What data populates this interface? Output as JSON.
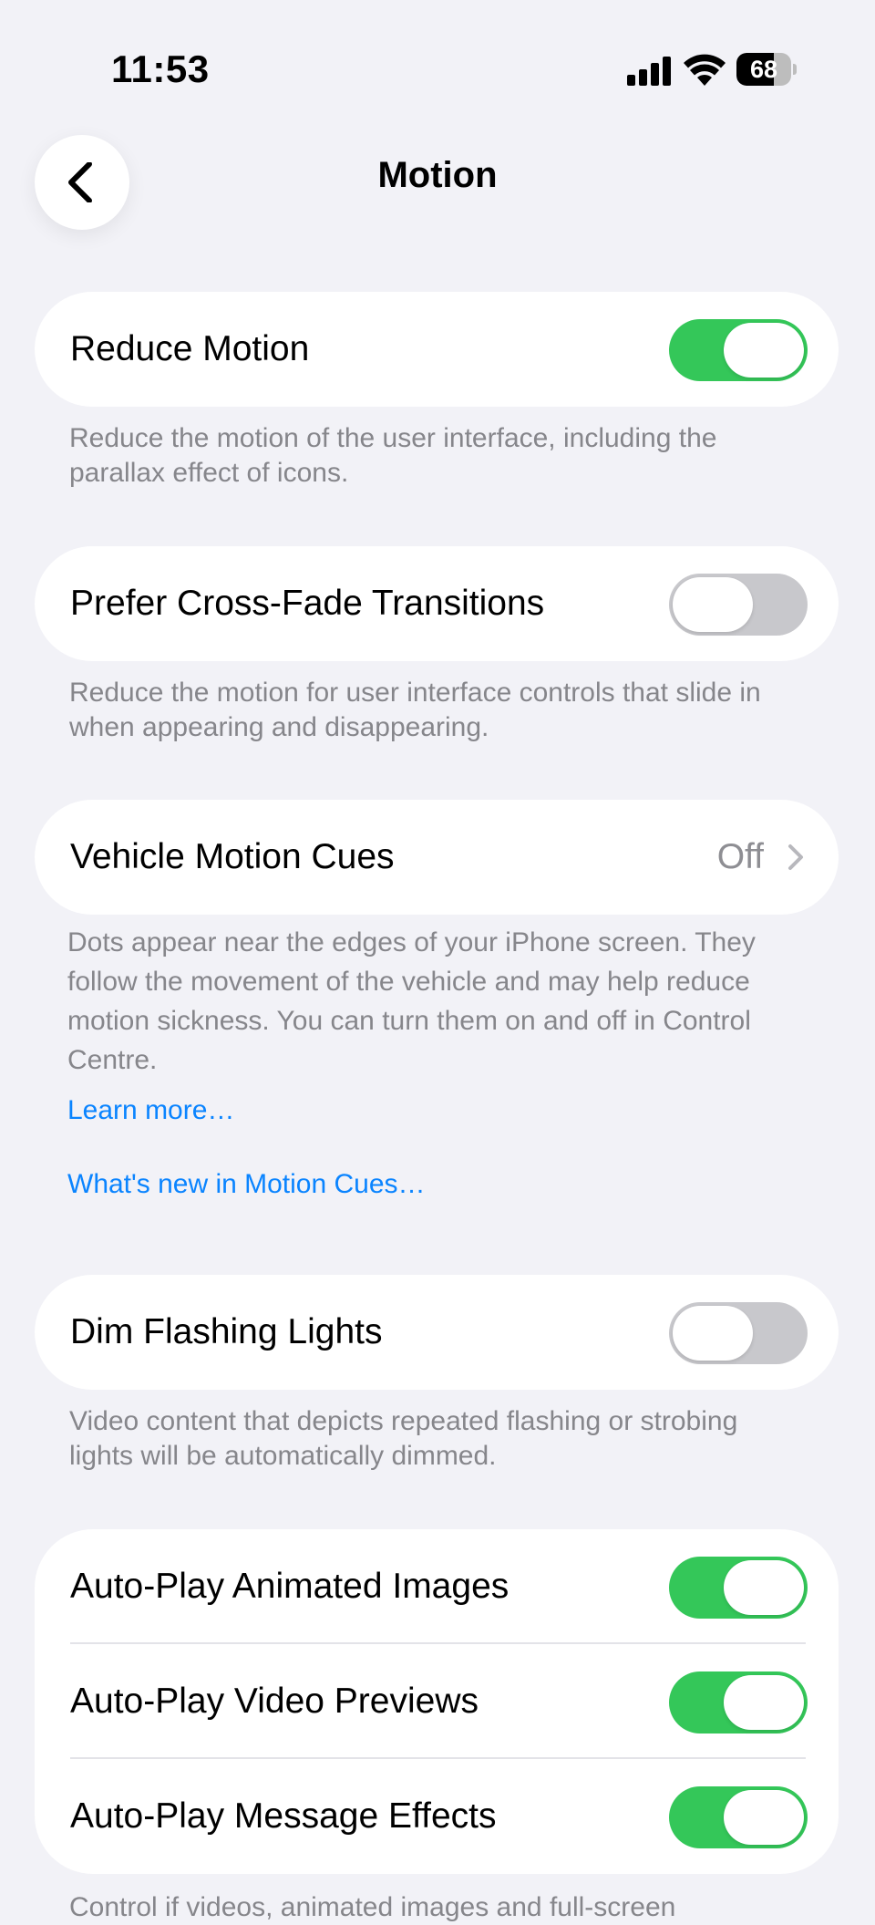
{
  "status_bar": {
    "time": "11:53",
    "battery": "68",
    "battery_level": 0.68
  },
  "nav": {
    "title": "Motion"
  },
  "settings": {
    "reduce_motion": {
      "label": "Reduce Motion",
      "on": true,
      "footer": "Reduce the motion of the user interface, including the parallax effect of icons."
    },
    "cross_fade": {
      "label": "Prefer Cross-Fade Transitions",
      "on": false,
      "footer": "Reduce the motion for user interface controls that slide in when appearing and disappearing."
    },
    "vehicle_motion_cues": {
      "label": "Vehicle Motion Cues",
      "value": "Off",
      "footer": "Dots appear near the edges of your iPhone screen. They follow the movement of the vehicle and may help reduce motion sickness. You can turn them on and off in Control Centre.",
      "learn_more": "Learn more…",
      "whats_new": "What's new in Motion Cues…"
    },
    "dim_flashing_lights": {
      "label": "Dim Flashing Lights",
      "on": false,
      "footer": "Video content that depicts repeated flashing or strobing lights will be automatically dimmed."
    },
    "auto_play": [
      {
        "label": "Auto-Play Animated Images",
        "on": true
      },
      {
        "label": "Auto-Play Video Previews",
        "on": true
      },
      {
        "label": "Auto-Play Message Effects",
        "on": true
      }
    ],
    "auto_play_footer": "Control if videos, animated images and full-screen"
  },
  "colors": {
    "background": "#F2F2F7",
    "toggle_on": "#34C759",
    "toggle_off": "#C8C8CC",
    "link": "#0A84FF",
    "secondary_text": "#86868B"
  }
}
